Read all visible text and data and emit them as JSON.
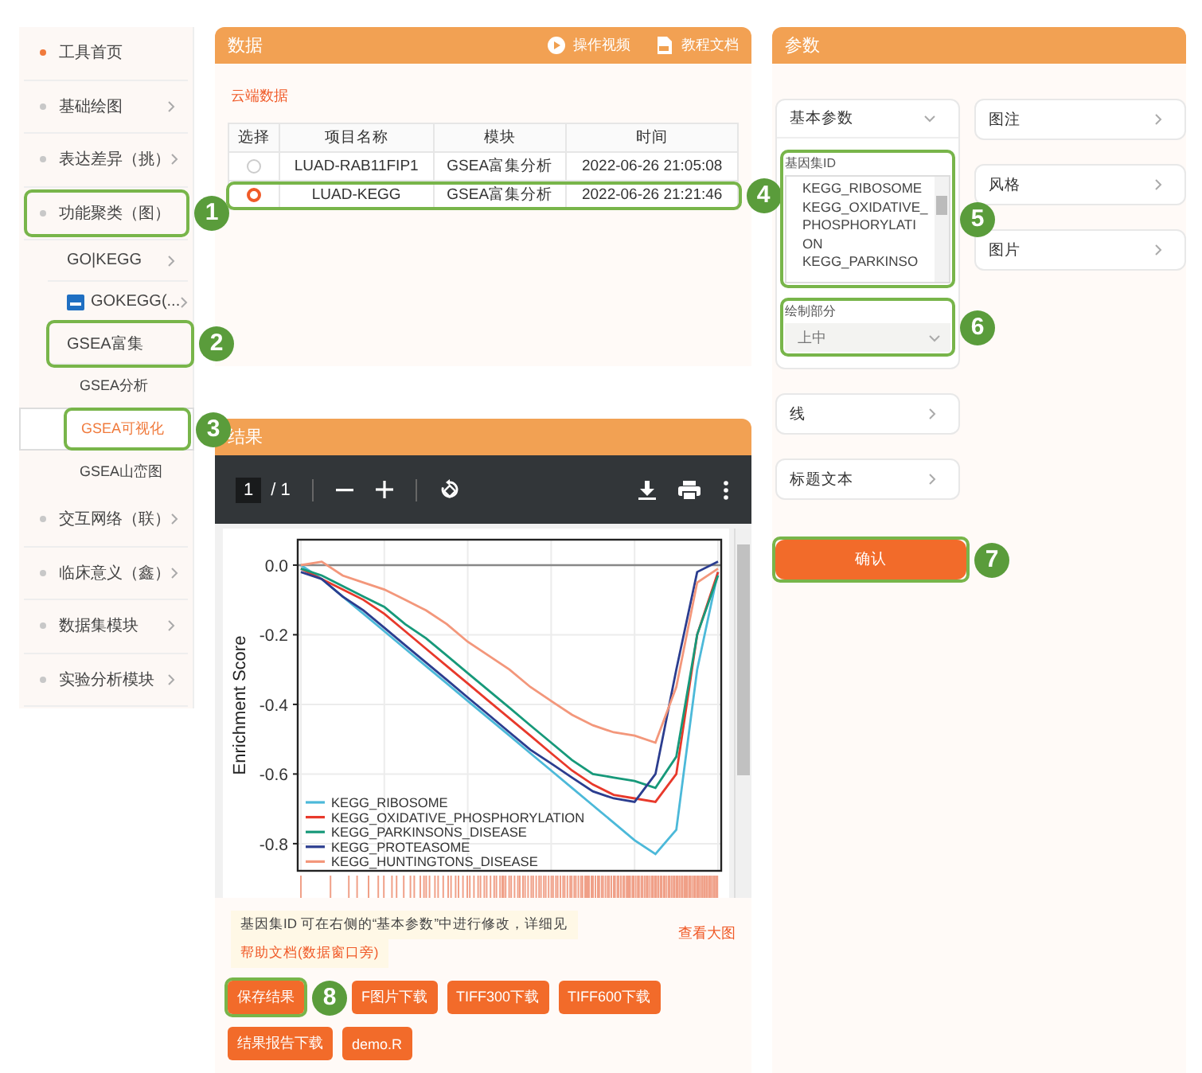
{
  "sidebar": {
    "items": [
      {
        "label": "工具首页",
        "kind": "link",
        "color": "#f07a3c",
        "selected": false
      },
      {
        "label": "基础绘图",
        "kind": "group",
        "color": "#c8c8c8",
        "expanded": false,
        "selected": false
      },
      {
        "label": "表达差异（挑）",
        "kind": "group",
        "color": "#c8c8c8",
        "expanded": false,
        "selected": false
      },
      {
        "label": "功能聚类（图）",
        "kind": "group",
        "color": "#c8c8c8",
        "expanded": true,
        "selected": false,
        "callout": "1",
        "children": [
          {
            "label": "GO|KEGG",
            "kind": "group",
            "expanded": false,
            "selected": false
          },
          {
            "label": "GOKEGG(...",
            "kind": "tool",
            "expanded": false,
            "selected": false
          },
          {
            "label": "GSEA富集",
            "kind": "group",
            "expanded": true,
            "selected": false,
            "callout": "2",
            "children": [
              {
                "label": "GSEA分析",
                "kind": "link",
                "selected": false
              },
              {
                "label": "GSEA可视化",
                "kind": "link",
                "selected": true,
                "callout": "3"
              },
              {
                "label": "GSEA山峦图",
                "kind": "link",
                "selected": false
              }
            ]
          }
        ]
      },
      {
        "label": "交互网络（联）",
        "kind": "group",
        "color": "#c8c8c8",
        "expanded": false,
        "selected": false
      },
      {
        "label": "临床意义（鑫）",
        "kind": "group",
        "color": "#c8c8c8",
        "expanded": false,
        "selected": false
      },
      {
        "label": "数据集模块",
        "kind": "group",
        "color": "#c8c8c8",
        "expanded": false,
        "selected": false
      },
      {
        "label": "实验分析模块",
        "kind": "group",
        "color": "#c8c8c8",
        "expanded": false,
        "selected": false
      }
    ]
  },
  "data_panel": {
    "title": "数据",
    "actions": [
      {
        "label": "操作视频",
        "kind": "video"
      },
      {
        "label": "教程文档",
        "kind": "doc"
      }
    ],
    "source_link": "云端数据",
    "table": {
      "columns": [
        "选择",
        "项目名称",
        "模块",
        "时间"
      ],
      "rows": [
        {
          "selected": false,
          "cells": [
            "",
            "LUAD-RAB11FIP1",
            "GSEA富集分析",
            "2022-06-26 21:05:08"
          ]
        },
        {
          "selected": true,
          "callout": "4",
          "cells": [
            "",
            "LUAD-KEGG",
            "GSEA富集分析",
            "2022-06-26 21:21:46"
          ]
        }
      ]
    }
  },
  "result_panel": {
    "title": "结果",
    "viewer": {
      "page": "1",
      "total": "/ 1"
    },
    "chart_data": {
      "type": "line",
      "ylabel": "Enrichment Score",
      "categories": [
        null,
        null,
        null,
        null,
        null,
        null,
        null,
        null,
        null,
        null,
        null,
        null,
        null,
        null,
        null,
        null,
        null,
        null,
        null,
        null,
        null
      ],
      "ylim": [
        -0.878,
        0.073
      ],
      "grid": true,
      "legend": true,
      "yticks": [
        {
          "value": 0,
          "label": "0.0"
        },
        {
          "value": -0.2,
          "label": "-0.2"
        },
        {
          "value": -0.4,
          "label": "-0.4"
        },
        {
          "value": -0.6,
          "label": "-0.6"
        },
        {
          "value": -0.8,
          "label": "-0.8"
        }
      ],
      "series": [
        {
          "name": "KEGG_RIBOSOME",
          "color": "#4cb9d9",
          "values": [
            0,
            -0.04,
            -0.09,
            -0.14,
            -0.19,
            -0.24,
            -0.29,
            -0.34,
            -0.39,
            -0.44,
            -0.49,
            -0.54,
            -0.59,
            -0.64,
            -0.69,
            -0.74,
            -0.79,
            -0.83,
            -0.76,
            -0.3,
            -0.02
          ]
        },
        {
          "name": "KEGG_OXIDATIVE_PHOSPHORYLATION",
          "color": "#e8392b",
          "values": [
            -0.01,
            -0.04,
            -0.07,
            -0.1,
            -0.14,
            -0.19,
            -0.24,
            -0.29,
            -0.34,
            -0.39,
            -0.44,
            -0.49,
            -0.54,
            -0.59,
            -0.63,
            -0.66,
            -0.67,
            -0.68,
            -0.6,
            -0.2,
            -0.02
          ]
        },
        {
          "name": "KEGG_PARKINSONS_DISEASE",
          "color": "#17997a",
          "values": [
            -0.01,
            -0.03,
            -0.06,
            -0.09,
            -0.12,
            -0.17,
            -0.21,
            -0.26,
            -0.31,
            -0.36,
            -0.41,
            -0.46,
            -0.51,
            -0.56,
            -0.6,
            -0.61,
            -0.62,
            -0.64,
            -0.55,
            -0.2,
            -0.03
          ]
        },
        {
          "name": "KEGG_PROTEASOME",
          "color": "#2b3d8f",
          "values": [
            -0.02,
            -0.04,
            -0.09,
            -0.13,
            -0.18,
            -0.23,
            -0.28,
            -0.33,
            -0.38,
            -0.43,
            -0.48,
            -0.53,
            -0.57,
            -0.61,
            -0.65,
            -0.67,
            -0.68,
            -0.6,
            -0.3,
            -0.02,
            0.01
          ]
        },
        {
          "name": "KEGG_HUNTINGTONS_DISEASE",
          "color": "#f3977b",
          "values": [
            0,
            0.01,
            -0.03,
            -0.05,
            -0.07,
            -0.1,
            -0.13,
            -0.17,
            -0.22,
            -0.26,
            -0.3,
            -0.35,
            -0.39,
            -0.43,
            -0.46,
            -0.48,
            -0.49,
            -0.51,
            -0.35,
            -0.05,
            -0.01
          ]
        }
      ]
    },
    "note": {
      "text": "基因集ID 可在右侧的“基本参数”中进行修改，详细见",
      "link": "帮助文档(数据窗口旁)"
    },
    "view_large": "查看大图",
    "buttons": [
      {
        "label": "保存结果",
        "callout": "8"
      },
      {
        "label": "F图片下载"
      },
      {
        "label": "TIFF300下载"
      },
      {
        "label": "TIFF600下载"
      },
      {
        "label": "结果报告下载"
      },
      {
        "label": "demo.R"
      }
    ]
  },
  "params_panel": {
    "title": "参数",
    "left_sections": [
      {
        "label": "基本参数",
        "expanded": true,
        "fields": [
          {
            "kind": "textarea",
            "label": "基因集ID",
            "callout": "5",
            "lines": [
              "KEGG_RIBOSOME",
              "KEGG_OXIDATIVE_",
              "PHOSPHORYLATI",
              "ON",
              "KEGG_PARKINSO"
            ]
          },
          {
            "kind": "select",
            "label": "绘制部分",
            "value": "上中",
            "disabled": true,
            "callout": "6"
          }
        ]
      },
      {
        "label": "线",
        "expanded": false
      },
      {
        "label": "标题文本",
        "expanded": false
      }
    ],
    "right_sections": [
      {
        "label": "图注",
        "expanded": false
      },
      {
        "label": "风格",
        "expanded": false
      },
      {
        "label": "图片",
        "expanded": false
      }
    ],
    "confirm": {
      "label": "确认",
      "callout": "7"
    }
  }
}
